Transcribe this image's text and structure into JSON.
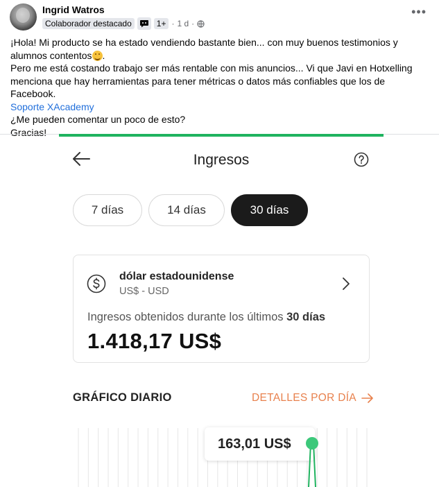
{
  "post": {
    "author": "Ingrid Watros",
    "badge": "Colaborador destacado",
    "badge_count": "1+",
    "separator_dot": "·",
    "time": "1 d",
    "more_icon": "more-options-icon",
    "lines": {
      "l1": "¡Hola! Mi producto se ha estado vendiendo bastante bien... con muy buenos testimonios y alumnos contentos",
      "l1_end": ".",
      "l2": "Pero me está costando trabajo ser más rentable con mis anuncios... Vi que Javi en Hotxelling menciona que hay herramientas para tener métricas o datos más confiables que los de Facebook.",
      "mention": "Soporte XAcademy",
      "l3": "¿Me pueden comentar un poco de esto?",
      "l4": "Gracias!"
    }
  },
  "app": {
    "accent_color": "#1fb35f",
    "title": "Ingresos",
    "range_tabs": [
      "7 días",
      "14 días",
      "30 días"
    ],
    "selected_tab": "30 días",
    "currency": {
      "name": "dólar estadounidense",
      "code": "US$ - USD"
    },
    "income": {
      "label_prefix": "Ingresos obtenidos durante los últimos",
      "label_bold": "30 días",
      "value": "1.418,17 US$"
    },
    "chart_section": {
      "title": "GRÁFICO DIARIO",
      "details_link": "DETALLES POR DÍA",
      "details_color": "#e8814d",
      "tooltip_value": "163,01 US$"
    }
  }
}
